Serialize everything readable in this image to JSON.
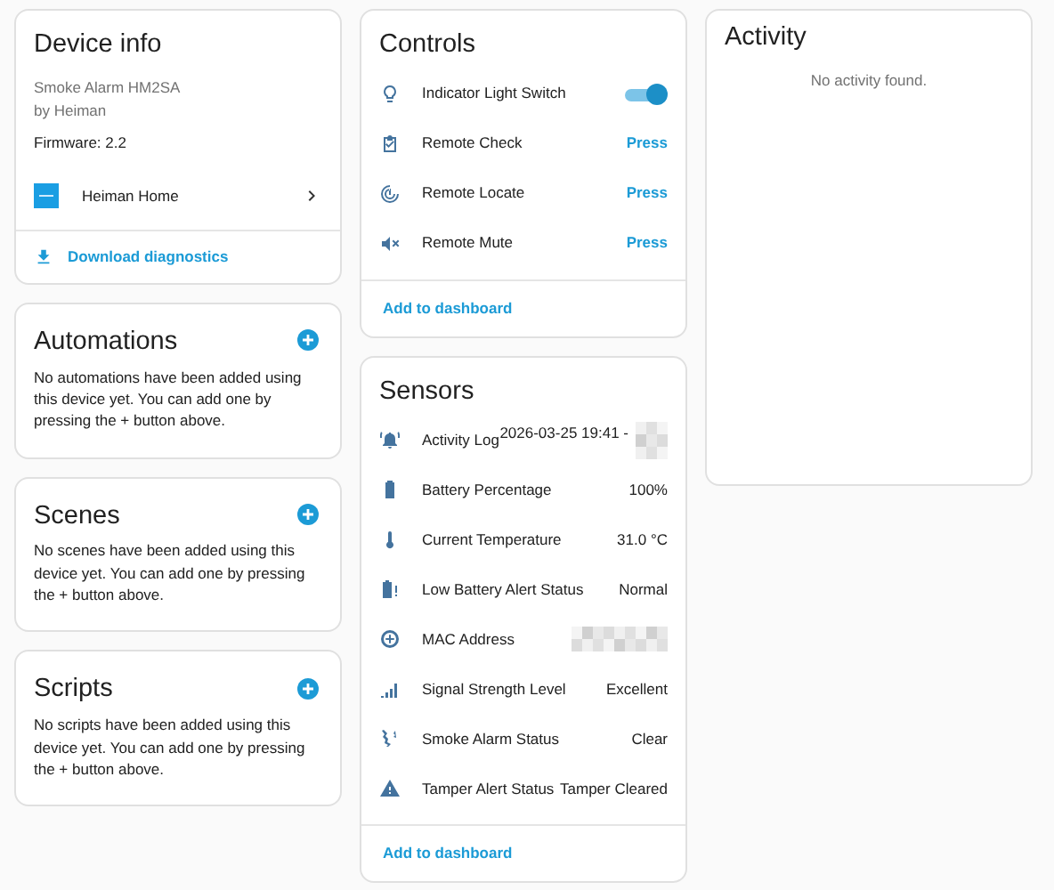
{
  "device_info": {
    "title": "Device info",
    "model": "Smoke Alarm HM2SA",
    "manufacturer": "by Heiman",
    "firmware": "Firmware: 2.2",
    "integration": "Heiman Home",
    "download": "Download diagnostics"
  },
  "sections": [
    {
      "title": "Automations",
      "message": "No automations have been added using this device yet. You can add one by pressing the + button above."
    },
    {
      "title": "Scenes",
      "message": "No scenes have been added using this device yet. You can add one by pressing the + button above."
    },
    {
      "title": "Scripts",
      "message": "No scripts have been added using this device yet. You can add one by pressing the + button above."
    }
  ],
  "controls": {
    "title": "Controls",
    "items": [
      {
        "kind": "switch",
        "name": "Indicator Light Switch",
        "on": true
      },
      {
        "kind": "button",
        "name": "Remote Check",
        "action": "Press"
      },
      {
        "kind": "button",
        "name": "Remote Locate",
        "action": "Press"
      },
      {
        "kind": "button",
        "name": "Remote Mute",
        "action": "Press"
      }
    ],
    "footer": "Add to dashboard"
  },
  "sensors": {
    "title": "Sensors",
    "items": [
      {
        "name": "Activity Log",
        "value": "2026-03-25 19:41 -",
        "blurred": true
      },
      {
        "name": "Battery Percentage",
        "value": "100%",
        "blurred": false
      },
      {
        "name": "Current Temperature",
        "value": "31.0 °C",
        "blurred": false
      },
      {
        "name": "Low Battery Alert Status",
        "value": "Normal",
        "blurred": false
      },
      {
        "name": "MAC Address",
        "blurred": true
      },
      {
        "name": "Signal Strength Level",
        "value": "Excellent",
        "blurred": false
      },
      {
        "name": "Smoke Alarm Status",
        "value": "Clear",
        "blurred": false
      },
      {
        "name": "Tamper Alert Status",
        "value": "Tamper Cleared",
        "blurred": false
      }
    ],
    "footer": "Add to dashboard"
  },
  "activity": {
    "title": "Activity",
    "message": "No activity found."
  }
}
